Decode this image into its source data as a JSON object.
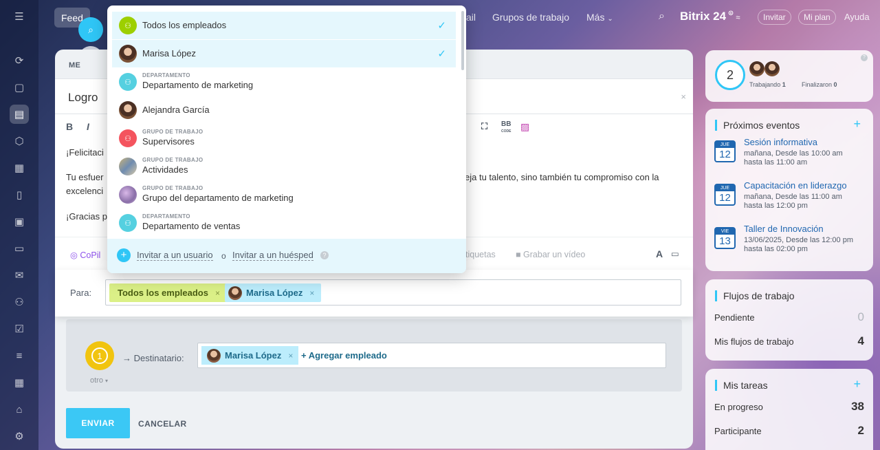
{
  "topbar": {
    "feed": "Feed",
    "partial_item": "ail",
    "workgroups": "Grupos de trabajo",
    "more": "Más",
    "brand": "Bitrix 24",
    "invite": "Invitar",
    "my_plan": "Mi plan",
    "help": "Ayuda"
  },
  "post": {
    "header": "ME",
    "title": "Logro",
    "editor_lines": [
      "¡Felicitaci",
      "Tu esfuer",
      "eja tu talento, sino también tu compromiso con la",
      "excelenci",
      "¡Gracias p"
    ],
    "bottom_tools": {
      "copilot": "CoPil",
      "tags": "tiquetas",
      "record_video": "Grabar un vídeo"
    }
  },
  "para": {
    "label": "Para:",
    "tags": [
      "Todos los empleados",
      "Marisa López"
    ]
  },
  "recipient": {
    "step": "1",
    "other": "otro",
    "label": "Destinatario:",
    "tag": "Marisa López",
    "add": "+ Agregar empleado"
  },
  "actions": {
    "send": "ENVIAR",
    "cancel": "CANCELAR"
  },
  "dropdown": {
    "items": [
      {
        "text": "Todos los empleados",
        "selected": true
      },
      {
        "text": "Marisa López",
        "selected": true
      },
      {
        "category": "DEPARTAMENTO",
        "text": "Departamento de marketing"
      },
      {
        "text": "Alejandra García"
      },
      {
        "category": "GRUPO DE TRABAJO",
        "text": "Supervisores"
      },
      {
        "category": "GRUPO DE TRABAJO",
        "text": "Actividades"
      },
      {
        "category": "GRUPO DE TRABAJO",
        "text": "Grupo del departamento de marketing"
      },
      {
        "category": "DEPARTAMENTO",
        "text": "Departamento de ventas"
      }
    ],
    "invite_user": "Invitar a un usuario",
    "or": "o",
    "invite_guest": "Invitar a un huésped"
  },
  "presence": {
    "count": "2",
    "working_label": "Trabajando",
    "working": "1",
    "finished_label": "Finalizaron",
    "finished": "0"
  },
  "events": {
    "title": "Próximos eventos",
    "items": [
      {
        "day": "JUE",
        "date": "12",
        "title": "Sesión informativa",
        "line1": "mañana, Desde las 10:00 am",
        "line2": "hasta las 11:00 am"
      },
      {
        "day": "JUE",
        "date": "12",
        "title": "Capacitación en liderazgo",
        "line1": "mañana, Desde las 11:00 am",
        "line2": "hasta las 12:00 pm"
      },
      {
        "day": "VIE",
        "date": "13",
        "title": "Taller de Innovación",
        "line1": "13/06/2025, Desde las 12:00 pm",
        "line2": "hasta las 02:00 pm"
      }
    ]
  },
  "workflows": {
    "title": "Flujos de trabajo",
    "pending_label": "Pendiente",
    "pending": "0",
    "mine_label": "Mis flujos de trabajo",
    "mine": "4"
  },
  "tasks": {
    "title": "Mis tareas",
    "in_progress_label": "En progreso",
    "in_progress": "38",
    "participant_label": "Participante",
    "participant": "2"
  }
}
